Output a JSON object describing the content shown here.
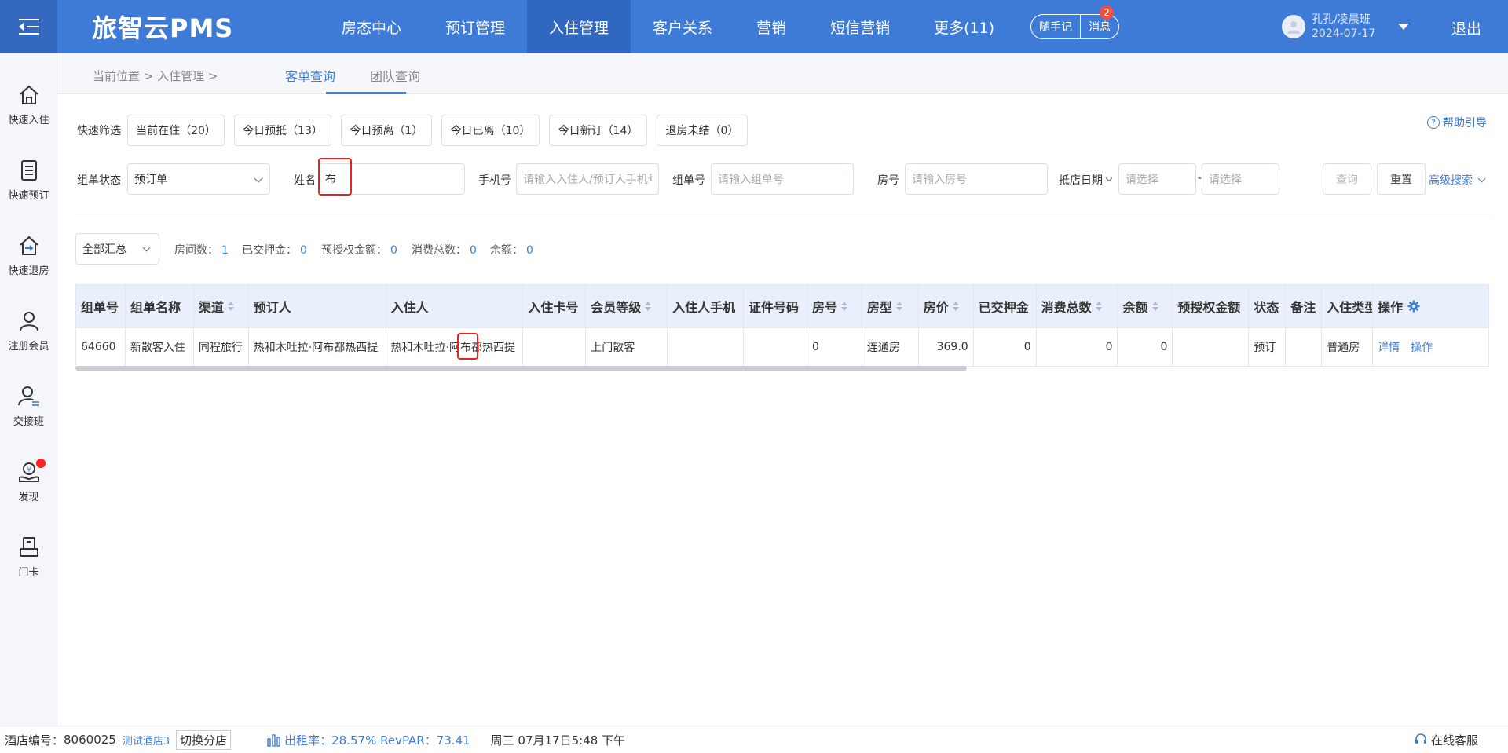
{
  "header": {
    "brand": "旅智云PMS",
    "nav": [
      "房态中心",
      "预订管理",
      "入住管理",
      "客户关系",
      "营销",
      "短信营销",
      "更多(11)"
    ],
    "active_nav": "入住管理",
    "memo": "随手记",
    "message": "消息",
    "message_badge": "2",
    "user_name": "孔孔/凌晨班",
    "user_date": "2024-07-17",
    "logout": "退出"
  },
  "sidebar": {
    "items": [
      "快速入住",
      "快速预订",
      "快速退房",
      "注册会员",
      "交接班",
      "发现",
      "门卡"
    ]
  },
  "breadcrumb": {
    "text": "当前位置 > 入住管理 >",
    "tabs": [
      "客单查询",
      "团队查询"
    ]
  },
  "quick_filter": {
    "label": "快速筛选",
    "chips": [
      "当前在住（20）",
      "今日预抵（13）",
      "今日预离（1）",
      "今日已离（10）",
      "今日新订（14）",
      "退房未结（0）"
    ],
    "help": "帮助引导"
  },
  "search": {
    "status_label": "组单状态",
    "status_value": "预订单",
    "name_label": "姓名",
    "name_value": "布",
    "phone_label": "手机号",
    "phone_placeholder": "请输入入住人/预订人手机号",
    "group_label": "组单号",
    "group_placeholder": "请输入组单号",
    "room_label": "房号",
    "room_placeholder": "请输入房号",
    "date_label": "抵店日期",
    "date_from_placeholder": "请选择",
    "date_sep": "-",
    "date_to_placeholder": "请选择",
    "query": "查询",
    "reset": "重置",
    "advanced": "高级搜索"
  },
  "summary": {
    "select": "全部汇总",
    "stats": [
      {
        "label": "房间数：",
        "value": "1"
      },
      {
        "label": "已交押金：",
        "value": "0"
      },
      {
        "label": "预授权金额：",
        "value": "0"
      },
      {
        "label": "消费总数：",
        "value": "0"
      },
      {
        "label": "余额：",
        "value": "0"
      }
    ]
  },
  "table": {
    "columns": [
      "组单号",
      "组单名称",
      "渠道",
      "预订人",
      "入住人",
      "入住卡号",
      "会员等级",
      "入住人手机",
      "证件号码",
      "房号",
      "房型",
      "房价",
      "已交押金",
      "消费总数",
      "余额",
      "预授权金额",
      "状态",
      "备注",
      "入住类型",
      "操作"
    ],
    "rows": [
      [
        "64660",
        "新散客入住",
        "同程旅行",
        "热和木吐拉·阿布都热西提",
        "热和木吐拉·阿布都热西提",
        "",
        "上门散客",
        "",
        "",
        "0",
        "连通房",
        "369.0",
        "0",
        "0",
        "0",
        "",
        "预订",
        "",
        "普通房",
        ""
      ]
    ],
    "actions": [
      "详情",
      "操作"
    ]
  },
  "footer": {
    "hotel_no_label": "酒店编号：",
    "hotel_no": "8060025",
    "hotel_name": "测试酒店3",
    "switch": "切换分店",
    "occupancy": "出租率：28.57% RevPAR：73.41",
    "datetime": "周三 07月17日5:48 下午",
    "service": "在线客服"
  },
  "colors": {
    "primary": "#3e7bd6",
    "header_dark": "#3067c1",
    "highlight_red": "#e8231e"
  }
}
